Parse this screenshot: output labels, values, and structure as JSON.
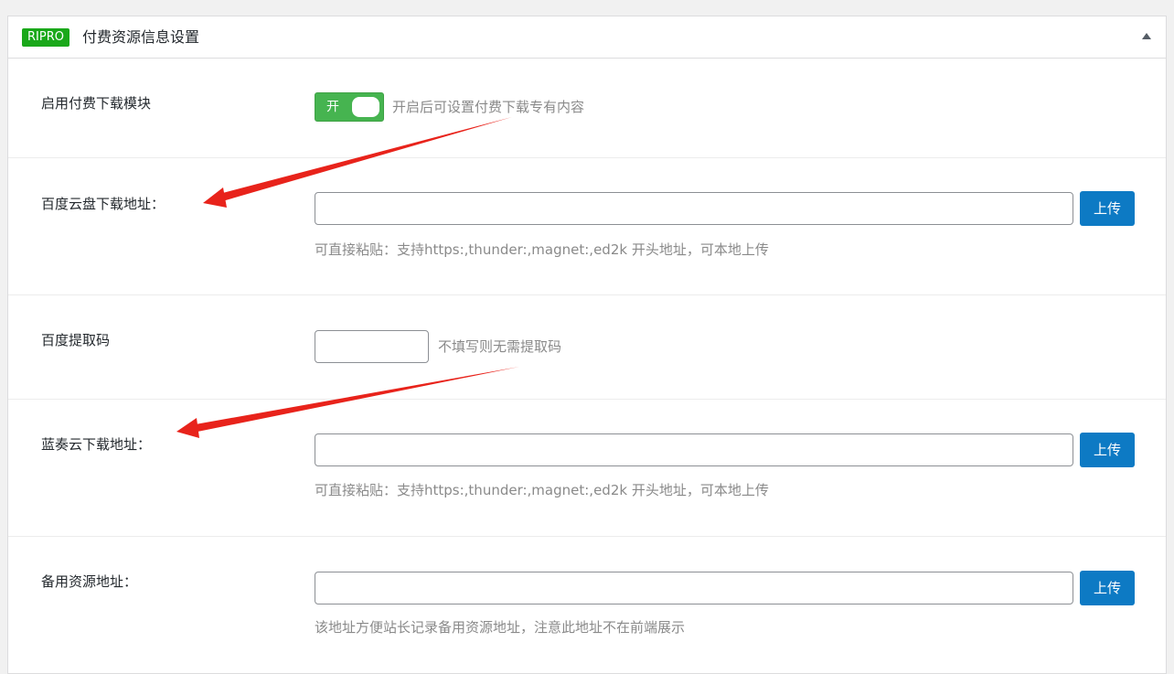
{
  "header": {
    "badge": "RIPRO",
    "title": "付费资源信息设置"
  },
  "rows": {
    "enable": {
      "label": "启用付费下载模块",
      "switch_label": "开",
      "switch_on": true,
      "help": "开启后可设置付费下载专有内容"
    },
    "baidu_url": {
      "label": "百度云盘下载地址：",
      "value": "",
      "upload_label": "上传",
      "help": "可直接粘贴：支持https:,thunder:,magnet:,ed2k 开头地址，可本地上传"
    },
    "baidu_code": {
      "label": "百度提取码",
      "value": "",
      "help": "不填写则无需提取码"
    },
    "lanzou_url": {
      "label": "蓝奏云下载地址：",
      "value": "",
      "upload_label": "上传",
      "help": "可直接粘贴：支持https:,thunder:,magnet:,ed2k 开头地址，可本地上传"
    },
    "backup_url": {
      "label": "备用资源地址：",
      "value": "",
      "upload_label": "上传",
      "help": "该地址方便站长记录备用资源地址，注意此地址不在前端展示"
    }
  },
  "colors": {
    "badge": "#1aa81a",
    "switch_on": "#46b450",
    "upload_button": "#0d7ac4",
    "annotation_arrow": "#e8231b"
  },
  "icons": {
    "collapse": "triangle-up-icon"
  }
}
